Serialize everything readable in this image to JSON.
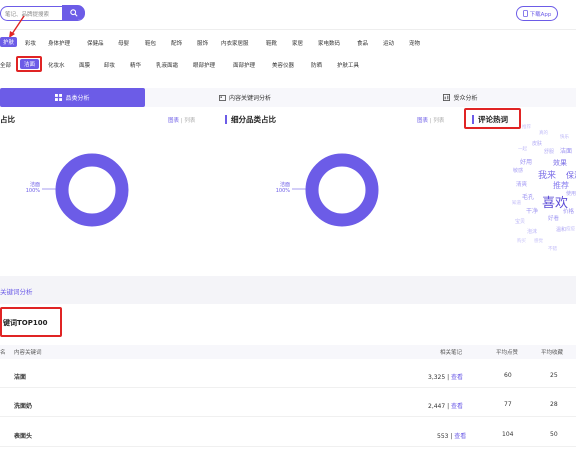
{
  "header": {
    "search_placeholder": "笔记、品牌提搜索",
    "download_label": "下载App"
  },
  "categories": [
    "护肤",
    "彩妆",
    "身体护理",
    "保健品",
    "母婴",
    "鞋包",
    "配饰",
    "服饰",
    "内衣家居服",
    "鞋靴",
    "家居",
    "家电数码",
    "食品",
    "运动",
    "宠物"
  ],
  "subcategories": [
    "全部",
    "洁面",
    "化妆水",
    "面膜",
    "卸妆",
    "精华",
    "乳液面霜",
    "眼部护理",
    "面部护理",
    "美容仪器",
    "防晒",
    "护肤工具"
  ],
  "tabs": [
    "品类分析",
    "内容关键词分析",
    "受众分析"
  ],
  "panels": {
    "left_title": "占比",
    "mid_title": "细分品类占比",
    "right_title": "评论热词",
    "toggle_on": "图表",
    "toggle_off": "列表",
    "donut_label": "洁面",
    "donut_value": "100%"
  },
  "wordcloud": [
    "喜欢",
    "我来",
    "推荐",
    "好用",
    "效果",
    "清爽",
    "毛孔",
    "皮肤",
    "洁面",
    "敏感",
    "舒服",
    "干净",
    "好看",
    "宝贝",
    "保湿",
    "泡沫",
    "温和",
    "价格",
    "真的",
    "一起",
    "快乐",
    "感觉",
    "知道",
    "使用",
    "购买",
    "痘痘",
    "不错",
    "推荐"
  ],
  "section2": {
    "title": "关键词分析",
    "subtitle": "键词TOP100"
  },
  "table": {
    "headers": [
      "名",
      "内容关键词",
      "相关笔记",
      "平均点赞",
      "平均收藏"
    ],
    "rows": [
      {
        "keyword": "洁面",
        "notes": "3,325",
        "link": "查看",
        "likes": "60",
        "collects": "25"
      },
      {
        "keyword": "洗面奶",
        "notes": "2,447",
        "link": "查看",
        "likes": "77",
        "collects": "28"
      },
      {
        "keyword": "表面头",
        "notes": "553",
        "link": "查看",
        "likes": "104",
        "collects": "50"
      }
    ]
  },
  "colors": {
    "accent": "#6c5ce7",
    "highlight": "#e02424"
  }
}
